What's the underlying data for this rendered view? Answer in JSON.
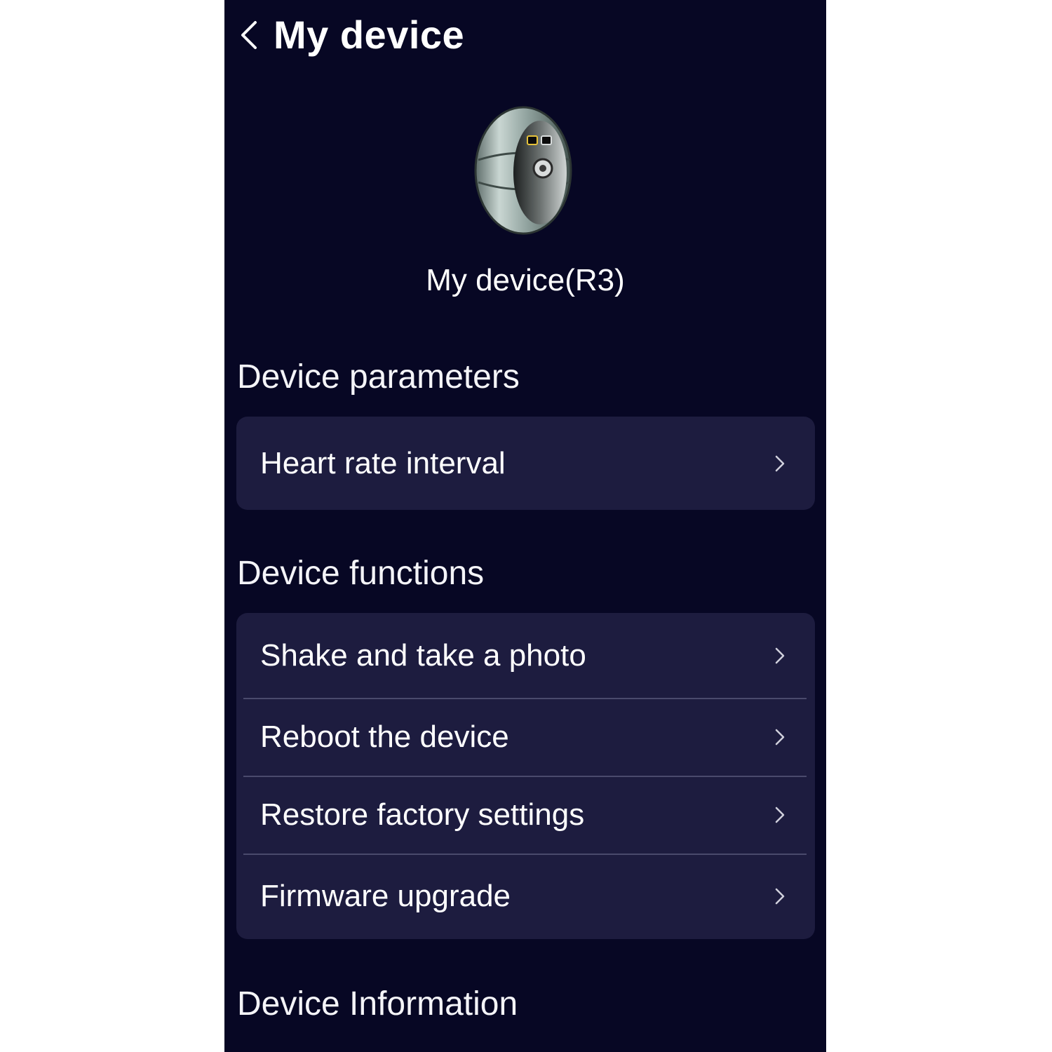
{
  "header": {
    "title": "My device",
    "back_icon": "chevron-left-icon"
  },
  "device": {
    "name": "My device(R3)",
    "image_icon": "smart-ring-image"
  },
  "sections": {
    "parameters": {
      "title": "Device parameters",
      "items": [
        {
          "label": "Heart rate interval"
        }
      ]
    },
    "functions": {
      "title": "Device functions",
      "items": [
        {
          "label": "Shake and take a photo"
        },
        {
          "label": "Reboot the device"
        },
        {
          "label": "Restore factory settings"
        },
        {
          "label": "Firmware upgrade"
        }
      ]
    },
    "information": {
      "title": "Device Information"
    }
  },
  "colors": {
    "background": "#070724",
    "card": "#1d1c3f",
    "divider": "#4a4a6c",
    "text": "#ffffff"
  }
}
